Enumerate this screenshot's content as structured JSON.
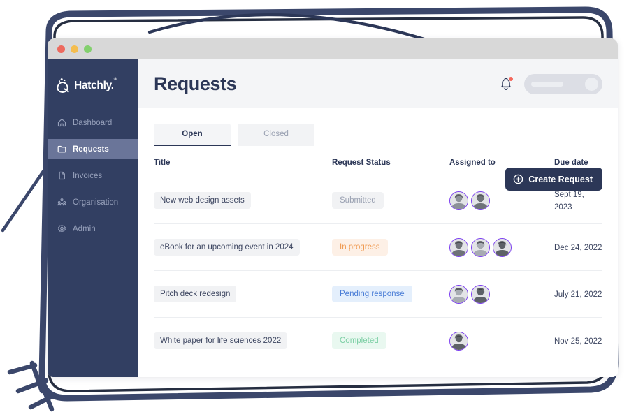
{
  "window": {
    "traffic_lights": [
      "close-red",
      "minimize-amber",
      "maximize-green"
    ]
  },
  "sidebar": {
    "brand": {
      "name": "Hatchly.",
      "trademark": "®",
      "icon": "hatchly-egg-logo"
    },
    "items": [
      {
        "label": "Dashboard",
        "icon": "home-icon",
        "active": false
      },
      {
        "label": "Requests",
        "icon": "folder-icon",
        "active": true
      },
      {
        "label": "Invoices",
        "icon": "document-icon",
        "active": false
      },
      {
        "label": "Organisation",
        "icon": "people-group-icon",
        "active": false
      },
      {
        "label": "Admin",
        "icon": "gear-icon",
        "active": false
      }
    ]
  },
  "topbar": {
    "title": "Requests",
    "bell_icon": "notification-bell-icon",
    "bell_has_badge": true,
    "account_pill": "account-skeleton-pill"
  },
  "tabs": [
    {
      "label": "Open",
      "active": true
    },
    {
      "label": "Closed",
      "active": false
    }
  ],
  "create_button": {
    "label": "Create Request",
    "icon": "plus-circle-icon"
  },
  "table": {
    "columns": [
      "Title",
      "Request Status",
      "Assigned to",
      "Due date"
    ],
    "rows": [
      {
        "title": "New web design assets",
        "status": "Submitted",
        "status_style": "submitted",
        "assignees": 2,
        "due_date": "Sept 19, 2023"
      },
      {
        "title": "eBook for an upcoming event in 2024",
        "status": "In progress",
        "status_style": "inprogress",
        "assignees": 3,
        "due_date": "Dec 24, 2022"
      },
      {
        "title": "Pitch deck redesign",
        "status": "Pending response",
        "status_style": "pending",
        "assignees": 2,
        "due_date": "July 21, 2022"
      },
      {
        "title": "White paper for life sciences 2022",
        "status": "Completed",
        "status_style": "completed",
        "assignees": 1,
        "due_date": "Nov 25, 2022"
      }
    ]
  },
  "annotations": {
    "top_arrow": "curved-arrow-pointing-to-create-request",
    "highlight_circle": "purple-circle-around-create-request",
    "left_arrow": "diagonal-line-pointing-to-sidebar",
    "corner_scribble": "scribble-marks-bottom-left"
  },
  "colors": {
    "navy": "#2c3757",
    "sidebar": "#323f62",
    "sidebar_active": "#6a7599",
    "purple": "#7c3ff0",
    "status_submitted_text": "#9aa1b2",
    "status_submitted_bg": "#f1f2f4",
    "status_inprogress_text": "#f0994f",
    "status_inprogress_bg": "#fdf0e6",
    "status_pending_text": "#4a7dd6",
    "status_pending_bg": "#e4effc",
    "status_completed_text": "#7ccfa4",
    "status_completed_bg": "#e9f8f0"
  }
}
